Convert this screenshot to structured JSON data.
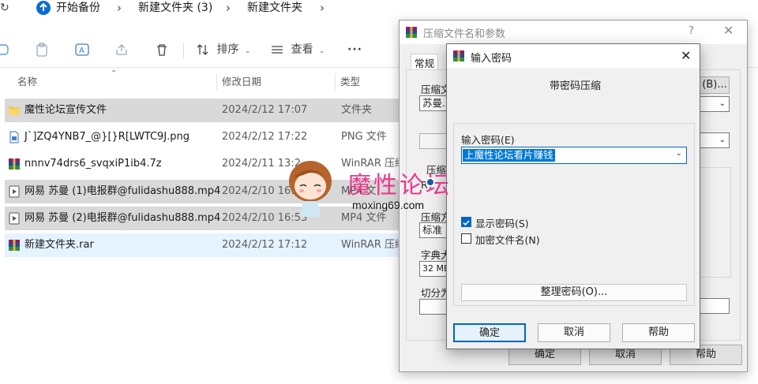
{
  "explorer": {
    "breadcrumb": [
      "开始备份",
      "新建文件夹 (3)",
      "新建文件夹"
    ],
    "toolbar": {
      "sort_label": "排序",
      "view_label": "查看",
      "more_label": "···"
    },
    "columns": {
      "name": "名称",
      "date": "修改日期",
      "type": "类型"
    },
    "files": [
      {
        "name": "魔性论坛宣传文件",
        "date": "2024/2/12 17:07",
        "type": "文件夹",
        "icon": "folder-icon"
      },
      {
        "name": "J`]ZQ4YNB7_@}[}R[LWTC9J.png",
        "date": "2024/2/12 17:22",
        "type": "PNG 文件",
        "icon": "png-file-icon"
      },
      {
        "name": "nnnv74drs6_svqxiP1ib4.7z",
        "date": "2024/2/11 13:2",
        "type": "WinRAR 压缩",
        "icon": "winrar-icon"
      },
      {
        "name": "网易 苏曼 (1)电报群@fulidashu888.mp4",
        "date": "2024/2/10 16:",
        "type": "MP4 文",
        "icon": "video-file-icon"
      },
      {
        "name": "网易 苏曼 (2)电报群@fulidashu888.mp4",
        "date": "2024/2/10 16:53",
        "type": "MP4 文件",
        "icon": "video-file-icon"
      },
      {
        "name": "新建文件夹.rar",
        "date": "2024/2/12 17:12",
        "type": "WinRAR 压缩",
        "icon": "winrar-icon"
      }
    ]
  },
  "watermark": {
    "text": "魔性论坛",
    "site": "moxing69.com"
  },
  "archive_dialog": {
    "title": "压缩文件名和参数",
    "help_glyph": "?",
    "tab": "常规",
    "archive_name_label": "压缩文",
    "archive_name_value": "苏曼.r",
    "browse_button": "(B)...",
    "format_label": "压缩",
    "radio_partial": "R",
    "method_label": "压缩方",
    "method_value": "标准",
    "dict_label": "字典大",
    "dict_value": "32 MB",
    "split_label": "切分为",
    "ok_button": "确定",
    "cancel_button": "取消",
    "help_button": "帮助"
  },
  "password_dialog": {
    "title": "输入密码",
    "subtitle": "带密码压缩",
    "enter_label": "输入密码(E)",
    "password_value": "上魔性论坛看片赚钱",
    "show_password_label": "显示密码(S)",
    "show_password_checked": true,
    "encrypt_names_label": "加密文件名(N)",
    "encrypt_names_checked": false,
    "organize_button": "整理密码(O)...",
    "ok_button": "确定",
    "cancel_button": "取消",
    "help_button": "帮助"
  }
}
